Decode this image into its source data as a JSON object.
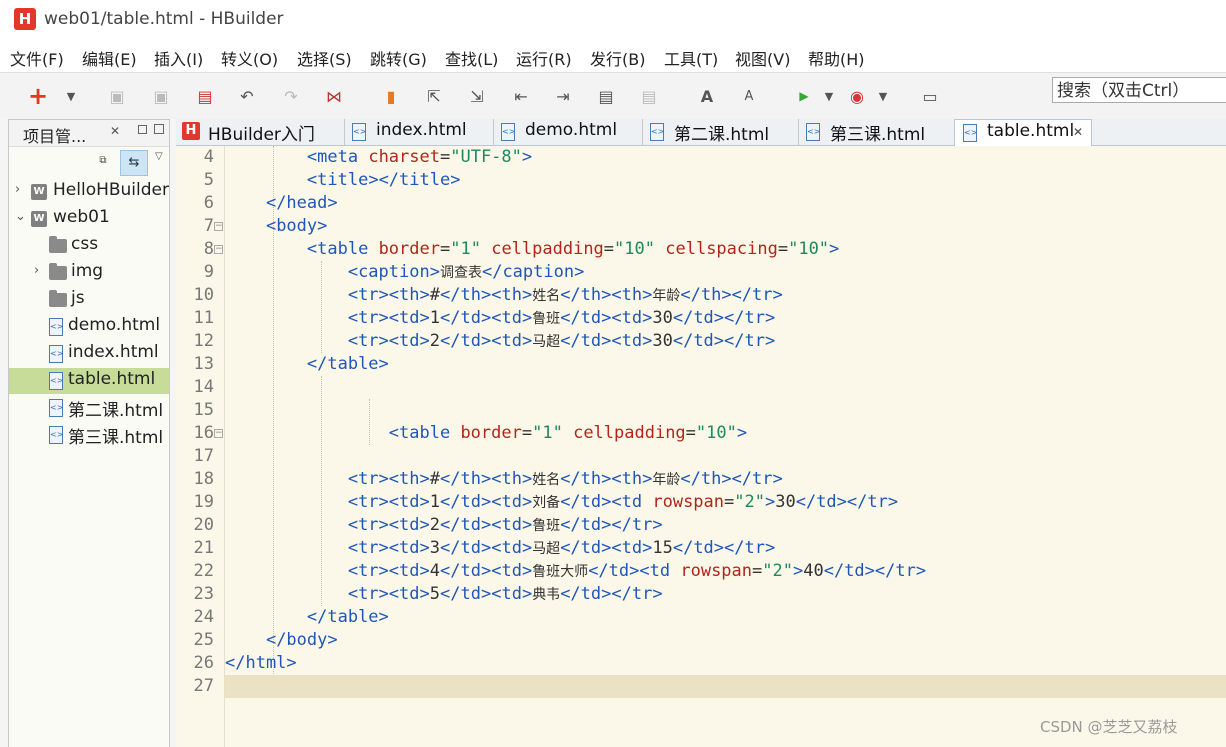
{
  "window": {
    "logo": "H",
    "title": "web01/table.html  -  HBuilder"
  },
  "menu": [
    "文件(F)",
    "编辑(E)",
    "插入(I)",
    "转义(O)",
    "选择(S)",
    "跳转(G)",
    "查找(L)",
    "运行(R)",
    "发行(B)",
    "工具(T)",
    "视图(V)",
    "帮助(H)"
  ],
  "search": {
    "label": "搜索（双击Ctrl）"
  },
  "sidebar": {
    "title": "项目管...",
    "tree": [
      {
        "label": "HelloHBuilder",
        "type": "project",
        "expand": "collapsed"
      },
      {
        "label": "web01",
        "type": "project",
        "expand": "expanded"
      },
      {
        "label": "css",
        "type": "folder",
        "expand": "none"
      },
      {
        "label": "img",
        "type": "folder",
        "expand": "collapsed"
      },
      {
        "label": "js",
        "type": "folder",
        "expand": "none"
      },
      {
        "label": "demo.html",
        "type": "file",
        "expand": "none"
      },
      {
        "label": "index.html",
        "type": "file",
        "expand": "none"
      },
      {
        "label": "table.html",
        "type": "file",
        "expand": "none",
        "selected": true
      },
      {
        "label": "第二课.html",
        "type": "file",
        "expand": "none"
      },
      {
        "label": "第三课.html",
        "type": "file",
        "expand": "none"
      }
    ]
  },
  "tabs": [
    {
      "label": "HBuilder入门",
      "icon": "hbuilder-logo-icon"
    },
    {
      "label": "index.html",
      "icon": "html-file-icon"
    },
    {
      "label": "demo.html",
      "icon": "html-file-icon"
    },
    {
      "label": "第二课.html",
      "icon": "html-file-icon"
    },
    {
      "label": "第三课.html",
      "icon": "html-file-icon"
    },
    {
      "label": "table.html",
      "icon": "html-file-icon",
      "active": true
    }
  ],
  "editor": {
    "lines": [
      {
        "n": "4",
        "code": "        <meta charset=\"UTF-8\">"
      },
      {
        "n": "5",
        "code": "        <title></title>"
      },
      {
        "n": "6",
        "code": "    </head>"
      },
      {
        "n": "7",
        "code": "    <body>",
        "fold": true
      },
      {
        "n": "8",
        "code": "        <table border=\"1\" cellpadding=\"10\" cellspacing=\"10\">",
        "fold": true
      },
      {
        "n": "9",
        "code": "            <caption>调查表</caption>"
      },
      {
        "n": "10",
        "code": "            <tr><th>#</th><th>姓名</th><th>年龄</th></tr>"
      },
      {
        "n": "11",
        "code": "            <tr><td>1</td><td>鲁班</td><td>30</td></tr>"
      },
      {
        "n": "12",
        "code": "            <tr><td>2</td><td>马超</td><td>30</td></tr>"
      },
      {
        "n": "13",
        "code": "        </table>"
      },
      {
        "n": "14",
        "code": ""
      },
      {
        "n": "15",
        "code": ""
      },
      {
        "n": "16",
        "code": "                <table border=\"1\" cellpadding=\"10\">",
        "fold": true
      },
      {
        "n": "17",
        "code": ""
      },
      {
        "n": "18",
        "code": "            <tr><th>#</th><th>姓名</th><th>年龄</th></tr>"
      },
      {
        "n": "19",
        "code": "            <tr><td>1</td><td>刘备</td><td rowspan=\"2\">30</td></tr>"
      },
      {
        "n": "20",
        "code": "            <tr><td>2</td><td>鲁班</td></tr>"
      },
      {
        "n": "21",
        "code": "            <tr><td>3</td><td>马超</td><td>15</td></tr>"
      },
      {
        "n": "22",
        "code": "            <tr><td>4</td><td>鲁班大师</td><td rowspan=\"2\">40</td></tr>"
      },
      {
        "n": "23",
        "code": "            <tr><td>5</td><td>典韦</td></tr>"
      },
      {
        "n": "24",
        "code": "        </table>"
      },
      {
        "n": "25",
        "code": "    </body>"
      },
      {
        "n": "26",
        "code": "</html>"
      },
      {
        "n": "27",
        "code": "",
        "current": true
      }
    ]
  },
  "watermark": "CSDN @芝芝又荔枝",
  "colors": {
    "tag": "#1f56b8",
    "attr": "#b0261a",
    "value": "#1b8a5e",
    "editor_bg": "#fbf8ea",
    "selected_tree": "#c6dc98"
  }
}
